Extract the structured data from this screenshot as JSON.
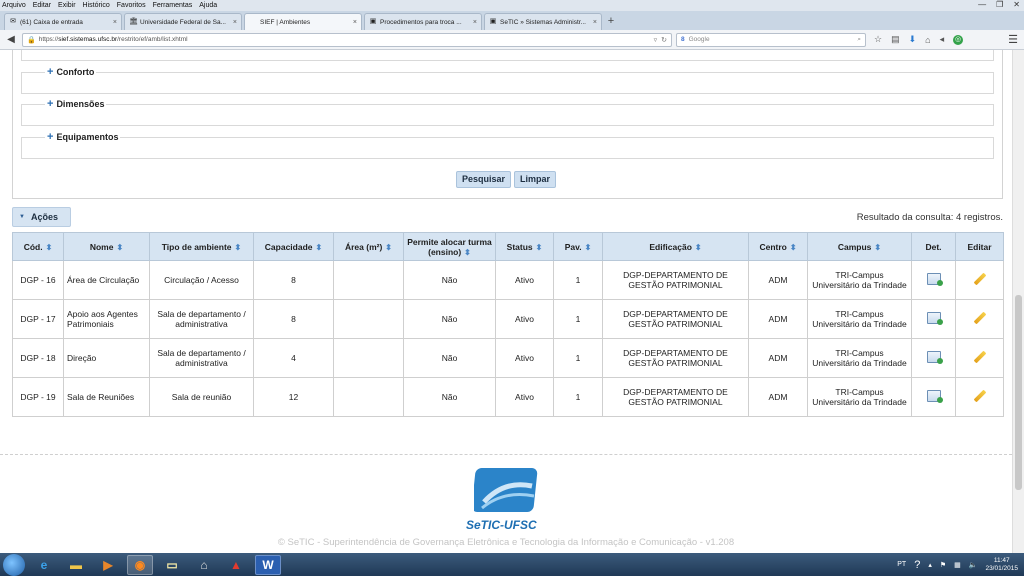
{
  "browser": {
    "menu": [
      "Arquivo",
      "Editar",
      "Exibir",
      "Histórico",
      "Favoritos",
      "Ferramentas",
      "Ajuda"
    ],
    "tabs": [
      {
        "icon": "mail-icon",
        "glyph": "✉",
        "title": "(61) Caixa de entrada",
        "active": false
      },
      {
        "icon": "university-icon",
        "glyph": "🏛",
        "title": "Universidade Federal de Sa...",
        "active": false
      },
      {
        "icon": "page-icon",
        "glyph": "",
        "title": "SIEF | Ambientes",
        "active": true
      },
      {
        "icon": "page-icon",
        "glyph": "▣",
        "title": "Procedimentos para troca ...",
        "active": false
      },
      {
        "icon": "page-icon",
        "glyph": "▣",
        "title": "SeTIC » Sistemas Administr...",
        "active": false
      }
    ],
    "url_prefix": "https://",
    "url_domain": "sief.sistemas.ufsc.br",
    "url_path": "/restrito/ef/amb/list.xhtml",
    "search_engine_label": "Google"
  },
  "filters": {
    "groups": [
      "Conforto",
      "Dimensões",
      "Equipamentos"
    ],
    "search_button": "Pesquisar",
    "clear_button": "Limpar"
  },
  "actions": {
    "label": "Ações",
    "result_text": "Resultado da consulta: 4 registros."
  },
  "table": {
    "headers": [
      "Cód.",
      "Nome",
      "Tipo de ambiente",
      "Capacidade",
      "Área (m²)",
      "Permite alocar turma (ensino)",
      "Status",
      "Pav.",
      "Edificação",
      "Centro",
      "Campus",
      "Det.",
      "Editar"
    ],
    "rows": [
      {
        "cod": "DGP - 16",
        "nome": "Área de Circulação",
        "tipo": "Circulação / Acesso",
        "capacidade": "8",
        "area": "",
        "permite": "Não",
        "status": "Ativo",
        "pav": "1",
        "edificacao": "DGP-DEPARTAMENTO DE GESTÃO PATRIMONIAL",
        "centro": "ADM",
        "campus": "TRI-Campus Universitário da Trindade"
      },
      {
        "cod": "DGP - 17",
        "nome": "Apoio aos Agentes Patrimoniais",
        "tipo": "Sala de departamento / administrativa",
        "capacidade": "8",
        "area": "",
        "permite": "Não",
        "status": "Ativo",
        "pav": "1",
        "edificacao": "DGP-DEPARTAMENTO DE GESTÃO PATRIMONIAL",
        "centro": "ADM",
        "campus": "TRI-Campus Universitário da Trindade"
      },
      {
        "cod": "DGP - 18",
        "nome": "Direção",
        "tipo": "Sala de departamento / administrativa",
        "capacidade": "4",
        "area": "",
        "permite": "Não",
        "status": "Ativo",
        "pav": "1",
        "edificacao": "DGP-DEPARTAMENTO DE GESTÃO PATRIMONIAL",
        "centro": "ADM",
        "campus": "TRI-Campus Universitário da Trindade"
      },
      {
        "cod": "DGP - 19",
        "nome": "Sala de Reuniões",
        "tipo": "Sala de reunião",
        "capacidade": "12",
        "area": "",
        "permite": "Não",
        "status": "Ativo",
        "pav": "1",
        "edificacao": "DGP-DEPARTAMENTO DE GESTÃO PATRIMONIAL",
        "centro": "ADM",
        "campus": "TRI-Campus Universitário da Trindade"
      }
    ]
  },
  "footer": {
    "logo_text": "SeTIC-UFSC",
    "copyright": "© SeTIC - Superintendência de Governança Eletrônica e Tecnologia da Informação e Comunicação - v1.208"
  },
  "taskbar": {
    "language": "PT",
    "time": "11:47",
    "date": "23/01/2015"
  },
  "colors": {
    "header_bg": "#d6e4f2",
    "button_bg": "#cfe0f1",
    "brand_blue": "#1f6fb2",
    "taskbar": "#1f3956"
  }
}
